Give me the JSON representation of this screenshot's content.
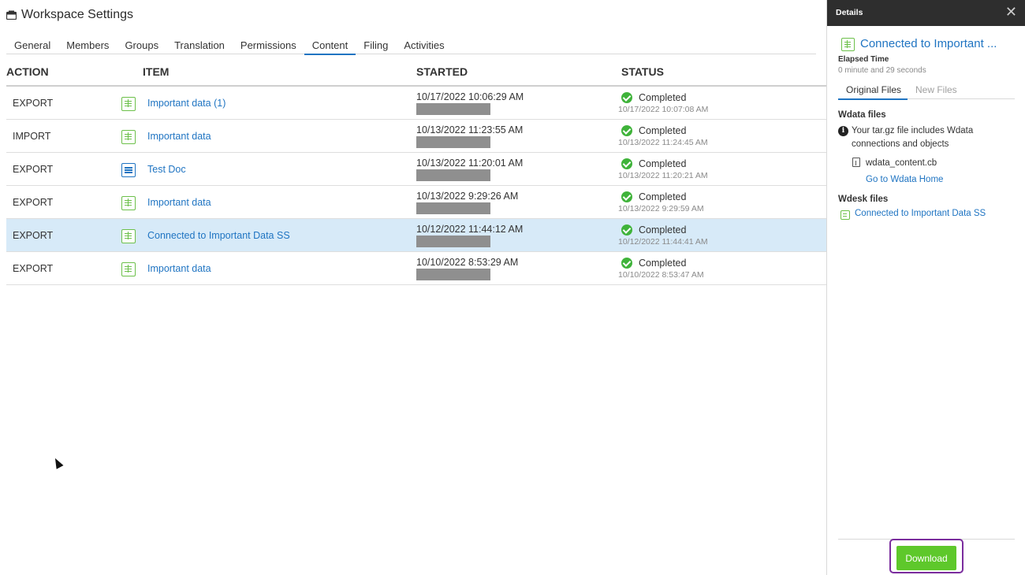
{
  "header": {
    "title": "Workspace Settings",
    "icon": "workspace-icon"
  },
  "tabs": [
    {
      "label": "General"
    },
    {
      "label": "Members"
    },
    {
      "label": "Groups"
    },
    {
      "label": "Translation"
    },
    {
      "label": "Permissions"
    },
    {
      "label": "Content",
      "active": true
    },
    {
      "label": "Filing"
    },
    {
      "label": "Activities"
    }
  ],
  "table": {
    "columns": {
      "action": "ACTION",
      "item": "ITEM",
      "started": "STARTED",
      "status": "STATUS"
    },
    "rows": [
      {
        "action": "EXPORT",
        "item": "Important data (1)",
        "item_icon": "spreadsheet-icon",
        "started": "10/17/2022 10:06:29 AM",
        "status": "Completed",
        "status_time": "10/17/2022 10:07:08 AM",
        "selected": false
      },
      {
        "action": "IMPORT",
        "item": "Important data",
        "item_icon": "spreadsheet-icon",
        "started": "10/13/2022 11:23:55 AM",
        "status": "Completed",
        "status_time": "10/13/2022 11:24:45 AM",
        "selected": false
      },
      {
        "action": "EXPORT",
        "item": "Test Doc",
        "item_icon": "document-icon",
        "started": "10/13/2022 11:20:01 AM",
        "status": "Completed",
        "status_time": "10/13/2022 11:20:21 AM",
        "selected": false
      },
      {
        "action": "EXPORT",
        "item": "Important data",
        "item_icon": "spreadsheet-icon",
        "started": "10/13/2022 9:29:26 AM",
        "status": "Completed",
        "status_time": "10/13/2022 9:29:59 AM",
        "selected": false
      },
      {
        "action": "EXPORT",
        "item": "Connected to Important Data SS",
        "item_icon": "spreadsheet-icon",
        "started": "10/12/2022 11:44:12 AM",
        "status": "Completed",
        "status_time": "10/12/2022 11:44:41 AM",
        "selected": true
      },
      {
        "action": "EXPORT",
        "item": "Important data",
        "item_icon": "spreadsheet-icon",
        "started": "10/10/2022 8:53:29 AM",
        "status": "Completed",
        "status_time": "10/10/2022 8:53:47 AM",
        "selected": false
      }
    ]
  },
  "details": {
    "header": "Details",
    "close_glyph": "✕",
    "title": "Connected to Important ...",
    "elapsed_label": "Elapsed Time",
    "elapsed_value": "0 minute and 29 seconds",
    "tabs": {
      "original": "Original Files",
      "new": "New Files"
    },
    "wdata_heading": "Wdata files",
    "wdata_info": "Your tar.gz file includes Wdata connections and objects",
    "wdata_file": "wdata_content.cb",
    "wdata_link": "Go to Wdata Home",
    "wdesk_heading": "Wdesk files",
    "wdesk_file": "Connected to Important Data SS",
    "download_label": "Download"
  },
  "colors": {
    "accent": "#1f74c2",
    "success": "#3fb33a",
    "download": "#5ec82b",
    "selected_row": "#d7eaf8",
    "highlight_outline": "#7b2d9e",
    "panel_header": "#2e2e2e"
  }
}
